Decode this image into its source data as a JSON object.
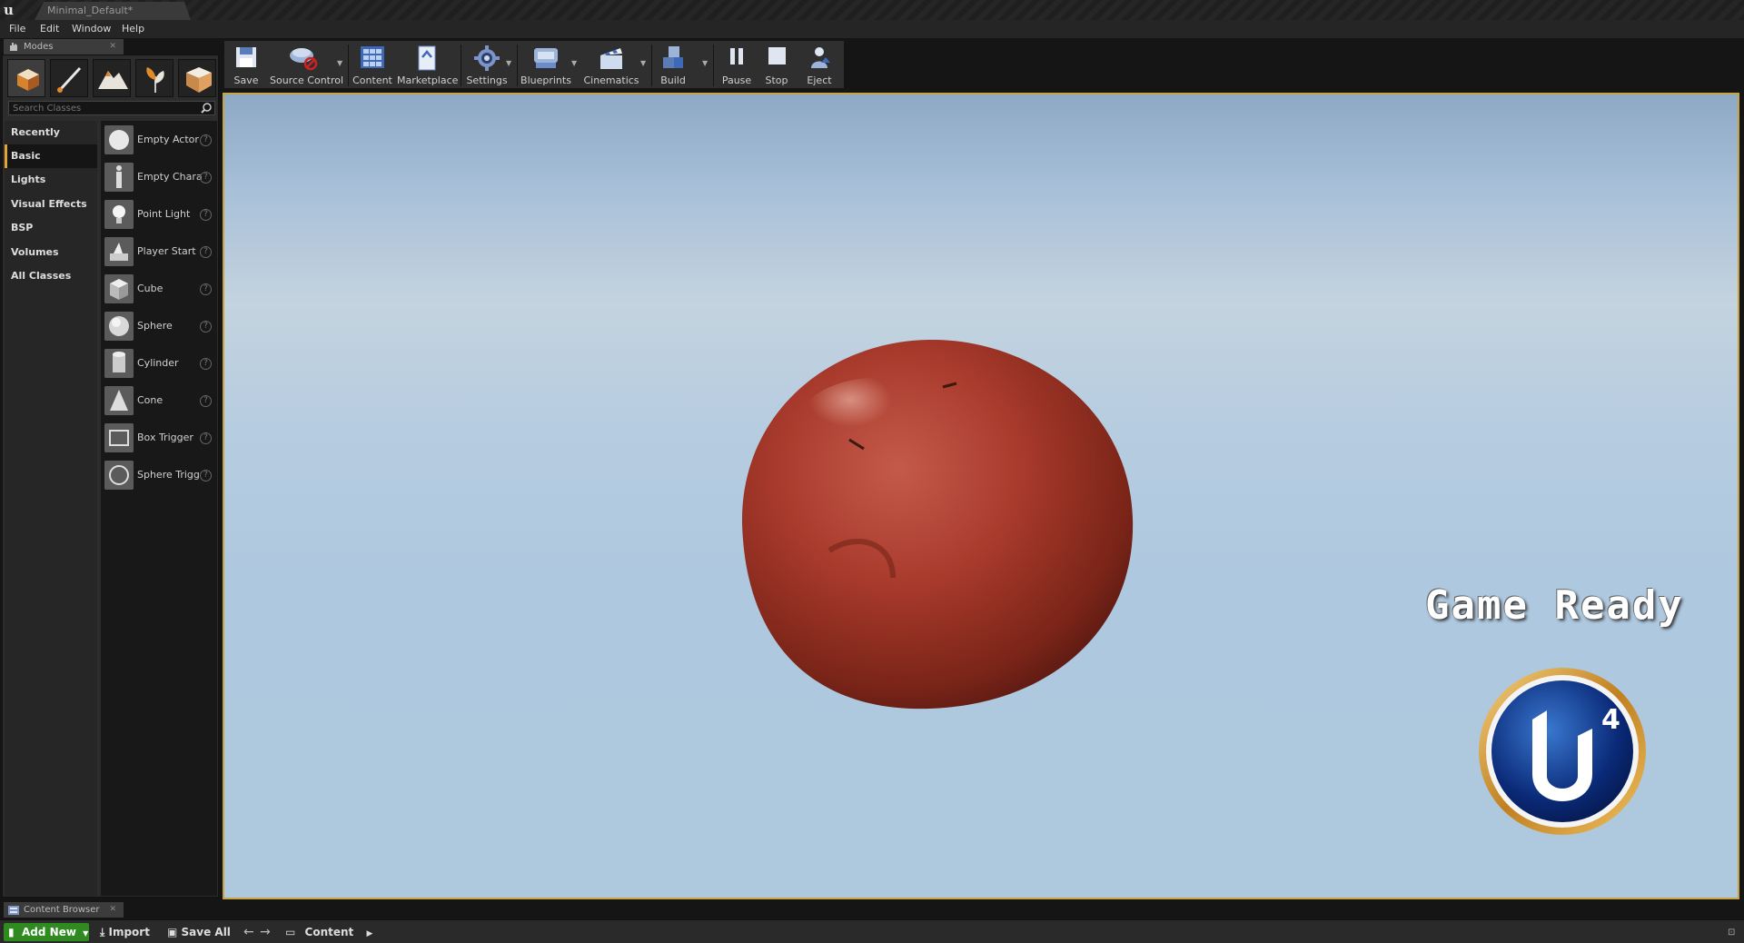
{
  "window": {
    "tab_title": "Minimal_Default*"
  },
  "menu": [
    "File",
    "Edit",
    "Window",
    "Help"
  ],
  "modes_panel": {
    "tab_label": "Modes",
    "search_placeholder": "Search Classes",
    "categories": [
      "Recently Placed",
      "Basic",
      "Lights",
      "Visual Effects",
      "BSP",
      "Volumes",
      "All Classes"
    ],
    "active_category": "Basic",
    "classes": [
      "Empty Actor",
      "Empty Chara",
      "Point Light",
      "Player Start",
      "Cube",
      "Sphere",
      "Cylinder",
      "Cone",
      "Box Trigger",
      "Sphere Trigg"
    ]
  },
  "toolbar": {
    "save": "Save",
    "source_control": "Source Control",
    "content": "Content",
    "marketplace": "Marketplace",
    "settings": "Settings",
    "blueprints": "Blueprints",
    "cinematics": "Cinematics",
    "build": "Build",
    "pause": "Pause",
    "stop": "Stop",
    "eject": "Eject"
  },
  "viewport": {
    "overlay_text": "Game Ready",
    "badge_number": "4",
    "border_color": "#c8a440"
  },
  "content_browser": {
    "tab_label": "Content Browser",
    "add_new": "Add New",
    "import": "Import",
    "save_all": "Save All",
    "path": "Content"
  },
  "colors": {
    "accent": "#e0a43a",
    "add_new_green": "#2f8a1f"
  }
}
